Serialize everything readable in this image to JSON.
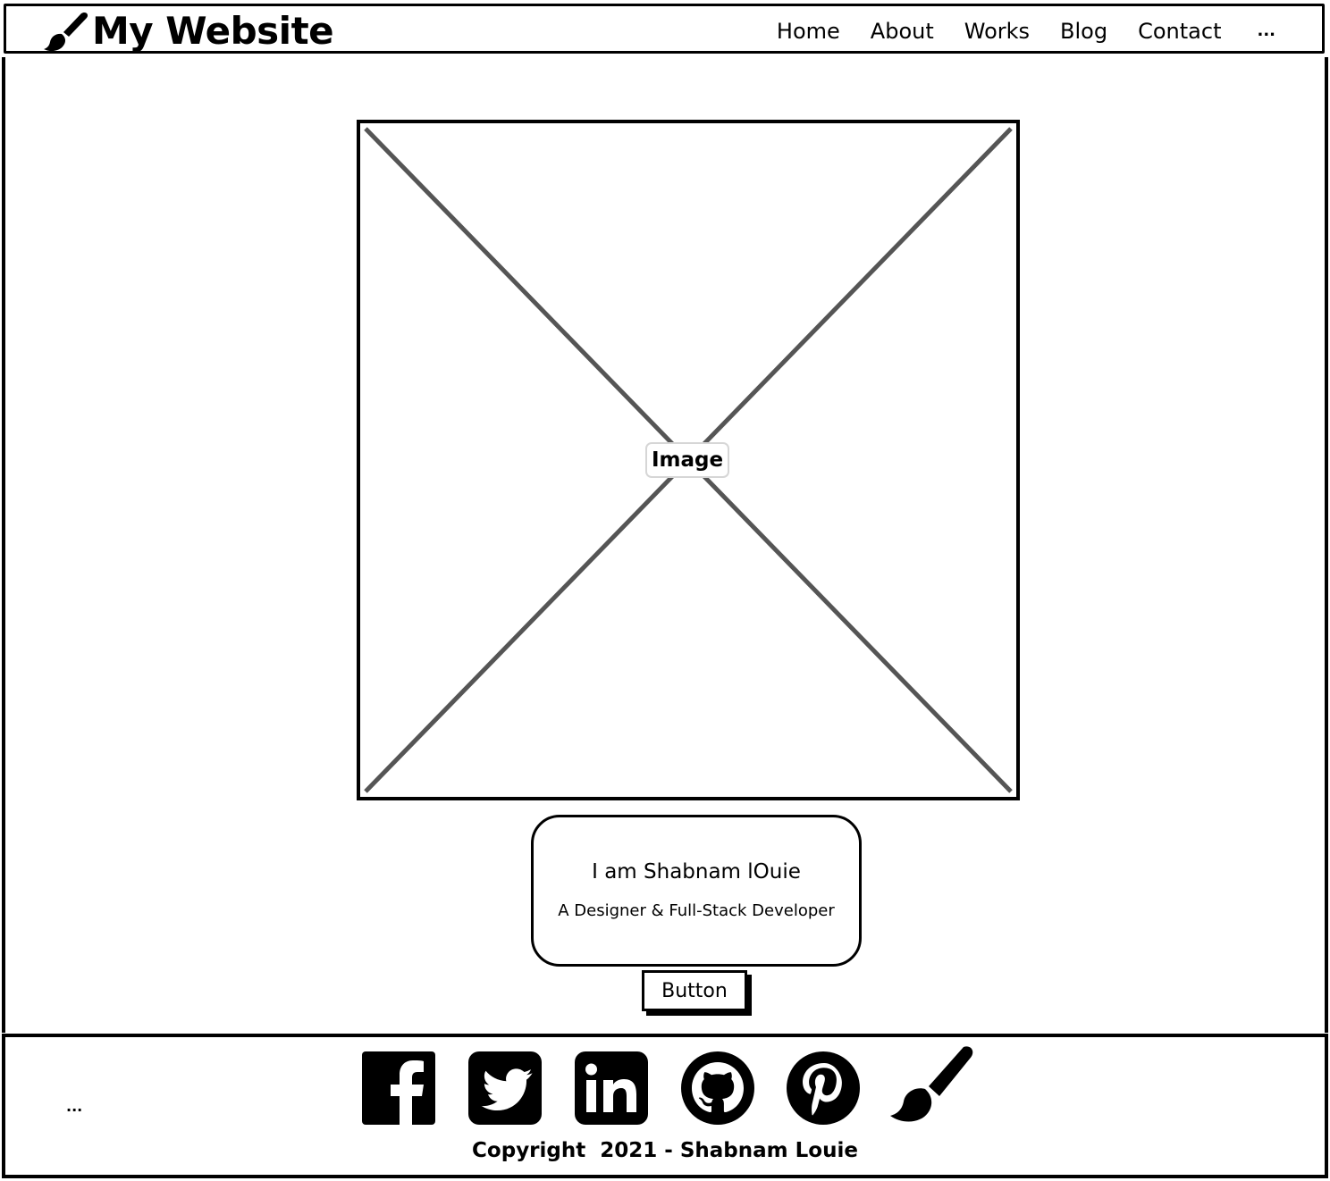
{
  "header": {
    "brand_title": "My Website",
    "brand_icon": "paintbrush-icon",
    "nav": [
      "Home",
      "About",
      "Works",
      "Blog",
      "Contact"
    ],
    "nav_more": "..."
  },
  "hero": {
    "image_label": "Image"
  },
  "intro": {
    "name": "I am Shabnam lOuie",
    "role": "A Designer & Full-Stack Developer"
  },
  "cta": {
    "button_label": "Button"
  },
  "footer": {
    "more": "...",
    "social_icons": [
      "facebook-icon",
      "twitter-icon",
      "linkedin-icon",
      "github-icon",
      "pinterest-icon",
      "paintbrush-icon"
    ],
    "copyright": "Copyright  2021 - Shabnam Louie"
  },
  "colors": {
    "ink": "#000000",
    "placeholder_cross": "#555555",
    "label_border": "#d6d6d6",
    "background": "#ffffff"
  }
}
